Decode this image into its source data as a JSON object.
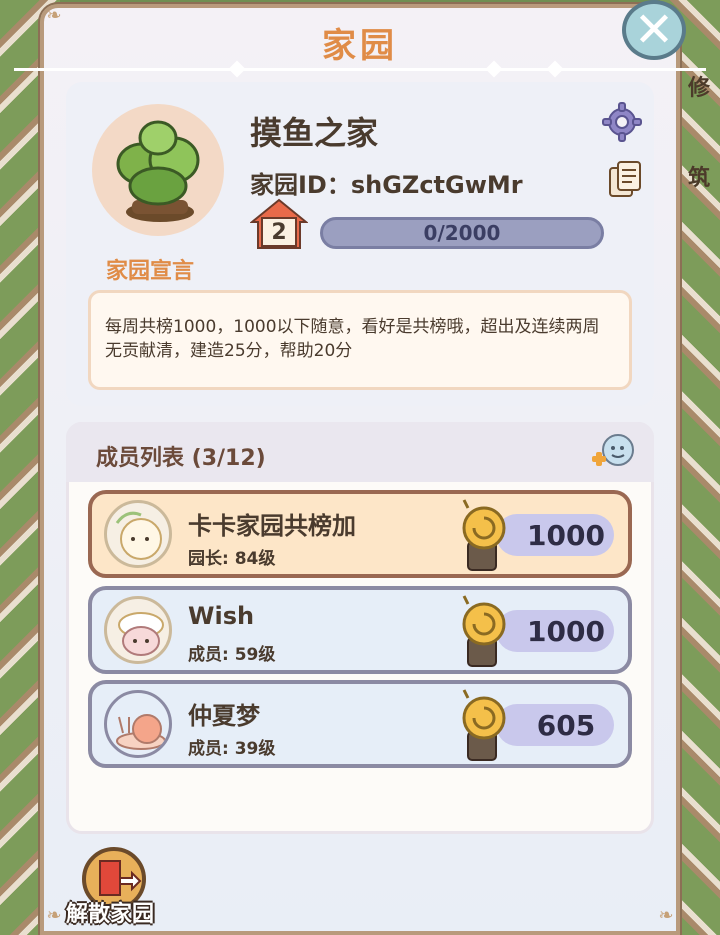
{
  "panel": {
    "title": "家园"
  },
  "side_texts": [
    "修",
    "筑"
  ],
  "home": {
    "name": "摸鱼之家",
    "id_text": "家园ID：shGZctGwMr",
    "declaration_label": "家园宣言",
    "level": "2",
    "progress_text": "0/2000",
    "progress_fraction": 0,
    "declaration": "每周共榜1000，1000以下随意，看好是共榜哦，超出及连续两周无贡献清，建造25分，帮助20分"
  },
  "members": {
    "title": "成员列表 (3/12)",
    "list": [
      {
        "name": "卡卡家园共榜加",
        "sub": "园长: 84级",
        "score": "1000",
        "role": "leader"
      },
      {
        "name": "Wish",
        "sub": "成员: 59级",
        "score": "1000",
        "role": "member"
      },
      {
        "name": "仲夏梦",
        "sub": "成员: 39级",
        "score": "605",
        "role": "member"
      }
    ]
  },
  "dissolve": {
    "label": "解散家园"
  },
  "colors": {
    "accent": "#e08c47",
    "panel_border": "#b89a7c",
    "leader_row": "#fde6c8",
    "member_row": "#e6eef8",
    "score_pill": "#c9c8ec"
  },
  "icons": {
    "close": "close-icon",
    "settings": "gear-icon",
    "copy": "copy-icon",
    "level": "house-icon",
    "chat": "chat-bubble-icon",
    "score": "snail-trophy-icon",
    "dissolve": "exit-door-icon"
  }
}
